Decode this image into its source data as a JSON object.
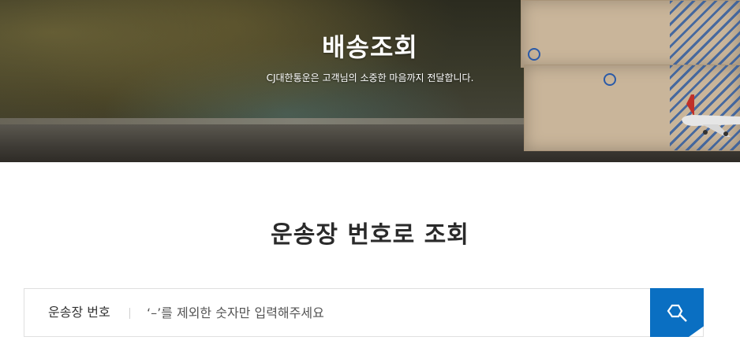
{
  "hero": {
    "title": "배송조회",
    "subtitle": "CJ대한통운은 고객님의 소중한 마음까지 전달합니다."
  },
  "section": {
    "title": "운송장 번호로 조회"
  },
  "search": {
    "label": "운송장 번호",
    "placeholder": "‘–’를 제외한 숫자만 입력해주세요",
    "value": "",
    "button_icon": "search-icon"
  },
  "colors": {
    "accent": "#0a6fc2",
    "title_text": "#2a2a2a",
    "hero_text": "#ffffff"
  }
}
